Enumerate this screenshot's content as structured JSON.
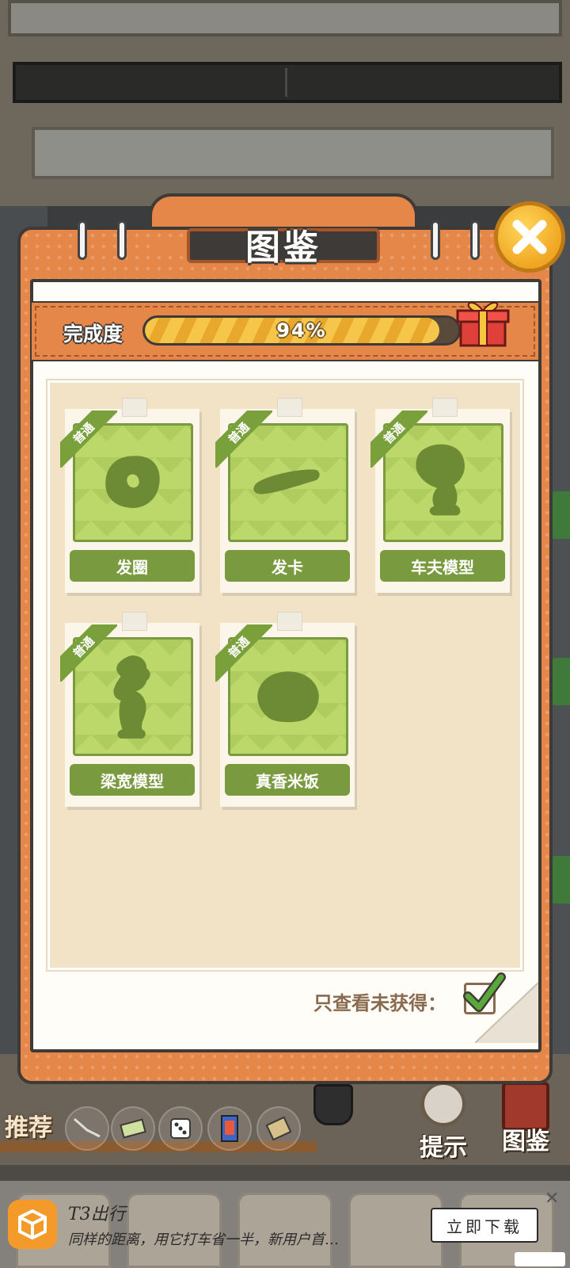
{
  "window": {
    "title": "图鉴"
  },
  "progress": {
    "label": "完成度",
    "percent_text": "94%",
    "value": 0.94
  },
  "cards": [
    {
      "tag": "普通",
      "name": "发圈",
      "icon": "hair-tie-silhouette"
    },
    {
      "tag": "普通",
      "name": "发卡",
      "icon": "hairpin-silhouette"
    },
    {
      "tag": "普通",
      "name": "车夫模型",
      "icon": "coachman-figure-silhouette"
    },
    {
      "tag": "普通",
      "name": "梁宽模型",
      "icon": "liang-kuan-figure-silhouette"
    },
    {
      "tag": "普通",
      "name": "真香米饭",
      "icon": "rice-bowl-silhouette"
    }
  ],
  "filter": {
    "label": "只查看未获得：",
    "checked": true
  },
  "bottom_bar": {
    "recommend_label": "推荐",
    "hint_label": "提示",
    "album_label": "图鉴"
  },
  "ad": {
    "app_name": "T3出行",
    "description": "同样的距离，用它打车省一半，新用户首…",
    "cta": "立即下载",
    "close": "✕"
  },
  "colors": {
    "panel": "#e6874a",
    "card_green": "#7a9a40",
    "progress_fill": "#f5c64a",
    "close_button": "#f0a622"
  }
}
